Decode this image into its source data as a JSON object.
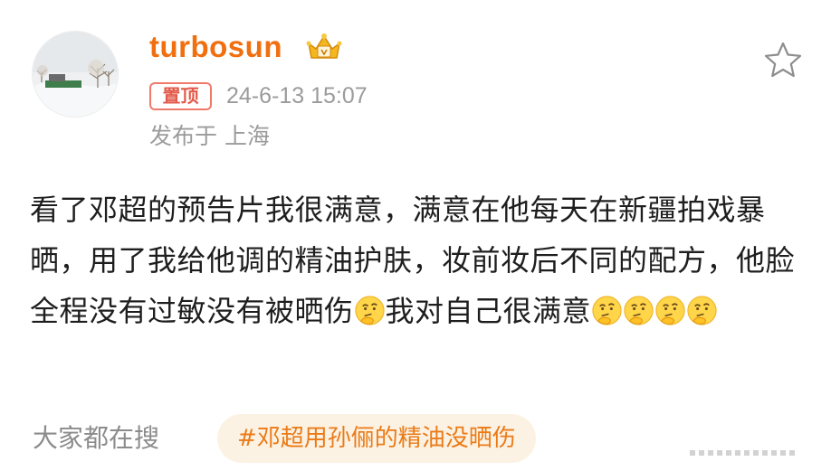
{
  "post": {
    "author": {
      "username": "turbosun",
      "avatar_icon": "snowy-landscape-avatar",
      "badge_icon": "gold-crown-badge-icon"
    },
    "pinned_label": "置顶",
    "timestamp": "24-6-13 15:07",
    "location": "发布于 上海",
    "favorite_icon": "star-outline-icon",
    "text_segments": [
      "看了邓超的预告片我很满意，满意在他每天在新疆拍戏暴晒，用了我给他调的精油护肤，妆前妆后不同的配方，他脸全程没有过敏没有被晒伤",
      "我对自己很满意"
    ],
    "emoji_name": "thinking-face-emoji"
  },
  "search": {
    "label": "大家都在搜",
    "hashtag": "#邓超用孙俪的精油没晒伤"
  },
  "colors": {
    "username": "#f06f0f",
    "pinned": "#e25a4a",
    "meta": "#9b9b9b",
    "hashtag_text": "#ea7b18",
    "hashtag_bg": "#fcf2e3"
  }
}
